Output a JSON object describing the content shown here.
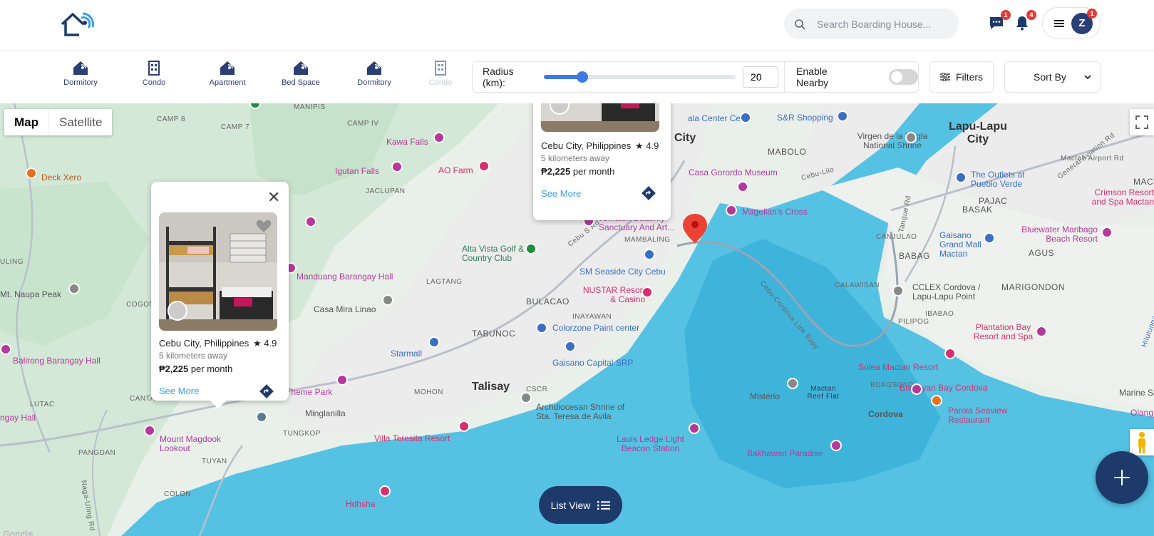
{
  "header": {
    "search_placeholder": "Search Boarding House...",
    "messages_badge": "1",
    "notifications_badge": "4",
    "avatar_initial": "Z",
    "avatar_badge": "1"
  },
  "categories": [
    {
      "label": "Dormitory",
      "icon": "house-signal-icon"
    },
    {
      "label": "Condo",
      "icon": "building-icon"
    },
    {
      "label": "Apartment",
      "icon": "house-signal-icon"
    },
    {
      "label": "Bed Space",
      "icon": "house-signal-icon"
    },
    {
      "label": "Dormitory",
      "icon": "house-signal-icon"
    },
    {
      "label": "Condo",
      "icon": "building-icon"
    }
  ],
  "radius": {
    "label": "Radius (km):",
    "value": "20",
    "slider_fraction": 0.2,
    "nearby_label": "Enable Nearby",
    "nearby_enabled": false
  },
  "filters_label": "Filters",
  "sort_label": "Sort By",
  "map": {
    "type_map": "Map",
    "type_satellite": "Satellite",
    "labels": {
      "camp8": "CAMP 8",
      "camp7": "CAMP 7",
      "camp4": "CAMP IV",
      "manipis": "MANIPIS",
      "kawa": "Kawa Falls",
      "igutan": "Igutan Falls",
      "aofarm": "AO Farm",
      "jaclupan": "JACLUPAN",
      "deckxero": "Deck Xero",
      "altavista": "Alta Vista Golf & Country Club",
      "manduang": "Manduang Barangay Hall",
      "lagtang": "LAGTANG",
      "mtnaupa": "Mt. Naupa Peak",
      "cogon": "COGON",
      "casamira": "Casa Mira Linao",
      "balirong": "Balirong Barangay Hall",
      "tabunoc": "TABUNOC",
      "bulacao": "BULACAO",
      "inayawan": "INAYAWAN",
      "starmall": "Starmall",
      "talisay": "Talisay",
      "mohon": "MOHON",
      "cscr": "CSCR",
      "minglanilla": "Minglanilla",
      "themepark": "Theme Park",
      "tungkop": "TUNGKOP",
      "archdio": "Archdiocesan Shrine of Sta. Teresa de Avila",
      "villateresita": "Villa Teresita Resort",
      "magdook": "Mount Magdook Lookout",
      "pangdan": "PANGDAN",
      "tuyan": "TUYAN",
      "colon": "COLON",
      "hdhsha": "Hdhsha",
      "lutac": "LUTAC",
      "ngayhall": "ngay Hall",
      "canta": "CANTA",
      "uling": "ULING",
      "cebucity": "City",
      "centercebu": "ala Center Cebu",
      "srshopping": "S&R Shopping",
      "mabolo": "MABOLO",
      "virgen": "Virgen de la Regla National Shrine",
      "lapulapu": "Lapu-Lapu City",
      "casagorordo": "Casa Gorordo Museum",
      "magellan": "Magellan's Cross",
      "jumalon": "Jumalon Butterfly Sanctuary And Art...",
      "mambaling": "MAMBALING",
      "smseaside": "SM Seaside City Cebu",
      "nustar": "NUSTAR Resort & Casino",
      "colorzone": "Colorzone Paint center",
      "gaisanocap": "Gaisano Capital SRP",
      "outlets": "The Outlets at Pueblo Verde",
      "pajac": "PAJAC",
      "basak": "BASAK",
      "crimson": "Crimson Resort and Spa Mactan",
      "mactanairport": "Mactan Airport Rd",
      "canjulao": "CANJULAO",
      "gaisanomactan": "Gaisano Grand Mall Mactan",
      "babag": "BABAG",
      "agus": "AGUS",
      "bluewater": "Bluewater Maribago Beach Resort",
      "calawisan": "CALAWISAN",
      "cclex": "CCLEX Cordova / Lapu-Lapu Point",
      "marigondon": "MARIGONDON",
      "ibabao": "IBABAO",
      "pilipog": "PILIPOG",
      "plantation": "Plantation Bay Resort and Spa",
      "solea": "Solea Mactan Resort",
      "buagsong": "BUAGSONG",
      "bantayan": "Bantayan Bay Cordova",
      "misterio": "Mistério",
      "mactanreef": "Mactan Reef Flat",
      "cordova": "Cordova",
      "parola": "Parola Seaview Restaurant",
      "laulan": "Lauis Ledge Light Beacon Station",
      "bakhawan": "Bakhawan Paradise",
      "cebucordova": "Cebu-Cordova Link Expy",
      "cebusrd": "Cebu S Rd",
      "marine": "Marine Sa",
      "olango": "Olang",
      "mact": "MACT",
      "generalaviation": "General Aviation Rd",
      "tangueroad": "Tangue Rd",
      "cebulilo": "Cebu-Lilo",
      "hilutungan": "Hilutungan Cha",
      "naga": "Naga-Uling Rd"
    }
  },
  "popups": [
    {
      "location": "Cebu City, Philippines",
      "rating": "★ 4.9",
      "distance": "5 kilometers away",
      "price": "₱2,225",
      "per": " per month",
      "see_more": "See More"
    },
    {
      "location": "Cebu City, Philippines",
      "rating": "★ 4.9",
      "distance": "5 kilometers away",
      "price": "₱2,225",
      "per": " per month",
      "see_more": "See More"
    }
  ],
  "list_view_label": "List View",
  "colors": {
    "primary": "#1e3a6b",
    "accent": "#3d78e3",
    "water": "#55c2e4",
    "land": "#e9efe9"
  }
}
